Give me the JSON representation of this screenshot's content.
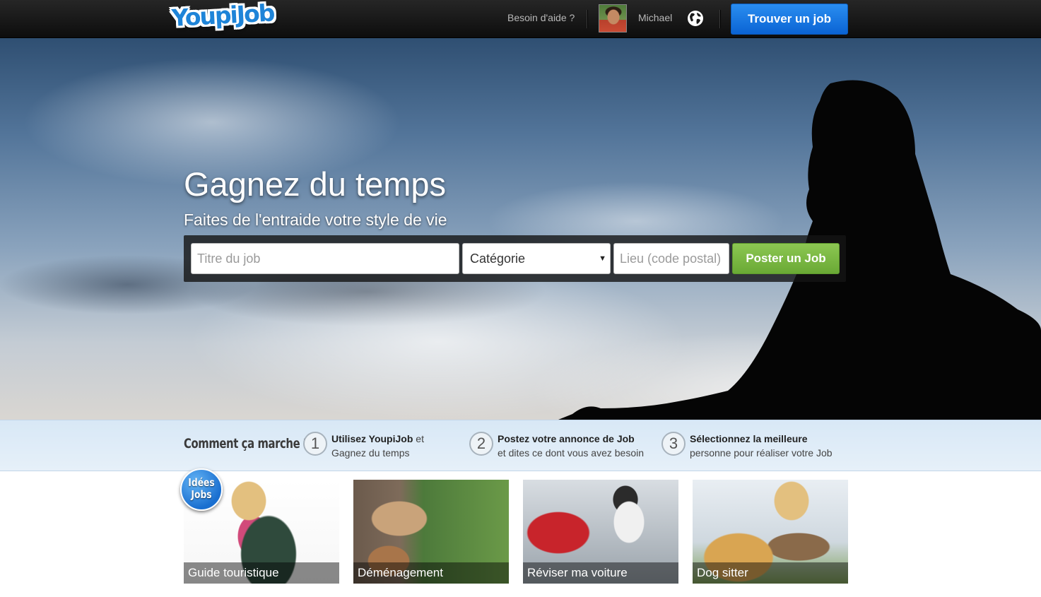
{
  "header": {
    "logo_text": "YoupiJob",
    "help_label": "Besoin d'aide ?",
    "user_name": "Michael",
    "find_job_label": "Trouver un job",
    "accent_color": "#0a63d4"
  },
  "hero": {
    "title": "Gagnez du temps",
    "subtitle": "Faites de l'entraide votre style de vie",
    "search": {
      "job_title_placeholder": "Titre du job",
      "category_selected": "Catégorie",
      "location_placeholder": "Lieu (code postal)",
      "post_button_label": "Poster un Job",
      "post_button_color": "#6aa935"
    }
  },
  "how_it_works": {
    "title": "Comment ça marche ?",
    "steps": [
      {
        "number": "1",
        "bold": "Utilisez YoupiJob",
        "rest": " et",
        "line2": "Gagnez du temps"
      },
      {
        "number": "2",
        "bold": "Postez votre annonce de Job",
        "rest": "",
        "line2": "et dites ce dont vous avez besoin"
      },
      {
        "number": "3",
        "bold": "Sélectionnez la meilleure",
        "rest": "",
        "line2": "personne pour réaliser votre Job"
      }
    ]
  },
  "job_ideas": {
    "badge_line1": "Idées",
    "badge_line2": "Jobs",
    "cards": [
      {
        "label": "Guide touristique"
      },
      {
        "label": "Déménagement"
      },
      {
        "label": "Réviser ma voiture"
      },
      {
        "label": "Dog sitter"
      }
    ]
  }
}
